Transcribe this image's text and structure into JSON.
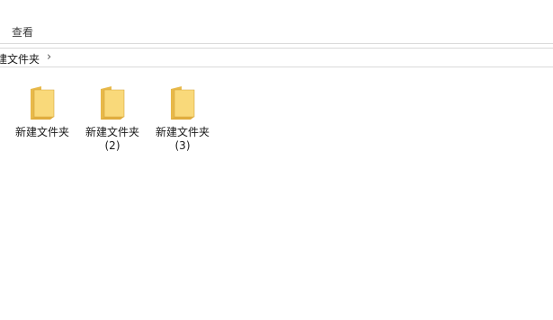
{
  "ribbon": {
    "view_tab": "查看"
  },
  "address_bar": {
    "path_segment": "建文件夹",
    "separator": "›"
  },
  "folders": [
    {
      "name_line1": "新建文件夹",
      "name_line2": ""
    },
    {
      "name_line1": "新建文件夹",
      "name_line2": "(2)"
    },
    {
      "name_line1": "新建文件夹",
      "name_line2": "(3)"
    }
  ],
  "colors": {
    "folder_front": "#f9d97a",
    "folder_back": "#e8b94a",
    "folder_edge": "#d4a43a",
    "divider": "#dadada"
  },
  "icons": {
    "folder": "folder-icon",
    "chevron": "chevron-right-icon"
  }
}
